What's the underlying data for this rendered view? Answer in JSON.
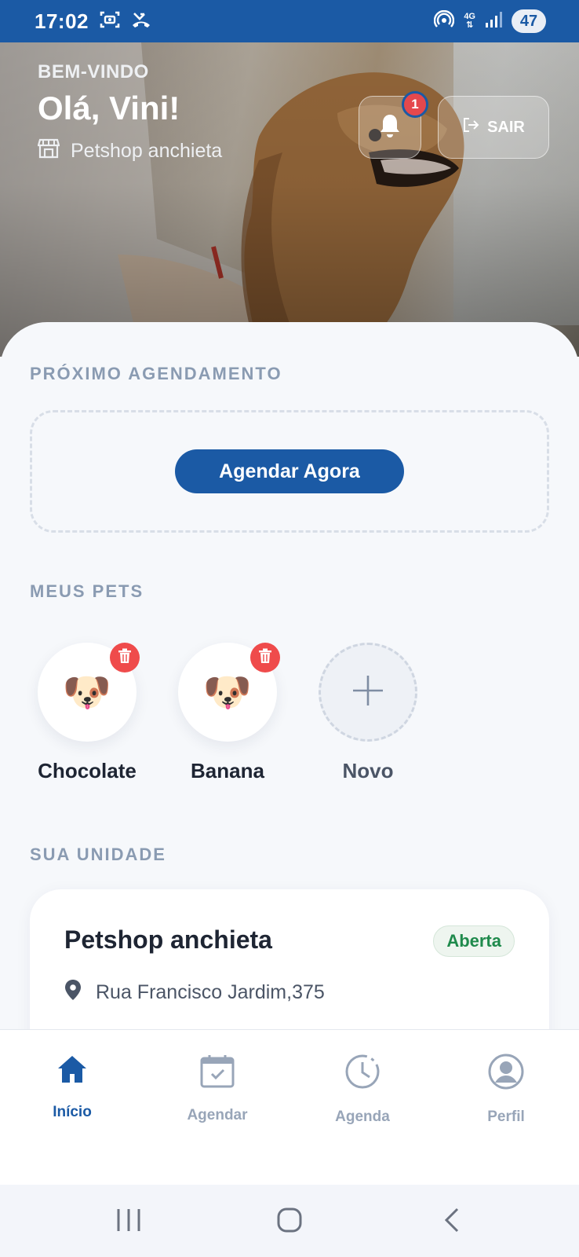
{
  "status_bar": {
    "time": "17:02",
    "network": "4G",
    "battery": "47",
    "icons": [
      "screen-record-icon",
      "missed-call-icon",
      "hotspot-icon",
      "signal-icon"
    ]
  },
  "hero": {
    "welcome_label": "BEM-VINDO",
    "greeting": "Olá, Vini!",
    "store_name": "Petshop anchieta",
    "notification_count": "1",
    "logout_label": "SAIR"
  },
  "next_appointment": {
    "section_title": "PRÓXIMO AGENDAMENTO",
    "button_label": "Agendar Agora"
  },
  "pets": {
    "section_title": "MEUS PETS",
    "items": [
      {
        "name": "Chocolate",
        "icon": "🐶"
      },
      {
        "name": "Banana",
        "icon": "🐶"
      }
    ],
    "add_label": "Novo"
  },
  "unit": {
    "section_title": "SUA UNIDADE",
    "name": "Petshop anchieta",
    "status": "Aberta",
    "address": "Rua Francisco Jardim,375"
  },
  "bottom_nav": {
    "items": [
      {
        "label": "Início",
        "icon": "home-icon",
        "active": true
      },
      {
        "label": "Agendar",
        "icon": "calendar-icon",
        "active": false
      },
      {
        "label": "Agenda",
        "icon": "clock-icon",
        "active": false
      },
      {
        "label": "Perfil",
        "icon": "user-icon",
        "active": false
      }
    ]
  },
  "colors": {
    "primary": "#1b5aa5",
    "danger": "#ef4b4b",
    "success": "#1f8a4c",
    "muted": "#8a9bb2"
  }
}
